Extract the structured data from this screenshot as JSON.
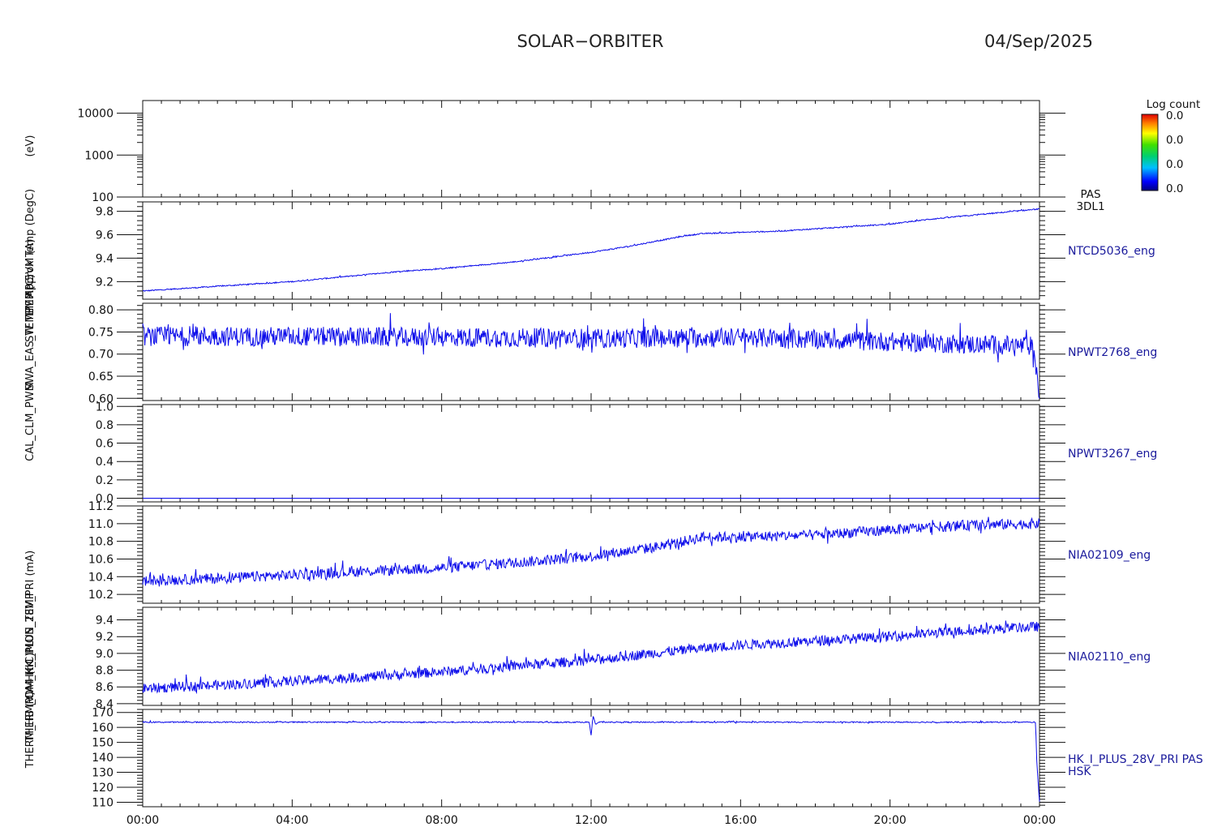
{
  "header": {
    "mission": "SOLAR−ORBITER",
    "date": "04/Sep/2025"
  },
  "colorbar": {
    "title": "Log count",
    "labels": [
      "0.0",
      "0.0",
      "0.0",
      "0.0"
    ]
  },
  "y_axis_labels": [
    "(eV)",
    "Approx Temp (DegC)",
    "TEMP 5VM (A)",
    "SW TEMP (C)",
    "SWA_EAS_TEMP",
    "CAL_CLM_PWM",
    "HK_I_PLUS_28V_PRI (mA)",
    "PDM_HK_IMON_TEMP",
    "THERM_CA4 (nC)",
    "THERM_HB (V)"
  ],
  "chart_data": [
    {
      "type": "heatmap",
      "label": "PAS\n3DL1",
      "label_lines": [
        "PAS",
        "3DL1"
      ],
      "yscale": "log",
      "ylim": [
        100,
        20000
      ],
      "yticks": [
        "100",
        "1000",
        "10000"
      ],
      "values": []
    },
    {
      "type": "line",
      "label": "NTCD5036_eng",
      "ylim": [
        9.05,
        9.88
      ],
      "yticks": [
        "9.2",
        "9.4",
        "9.6",
        "9.8"
      ],
      "x_hours": [
        0,
        1,
        2,
        3,
        4,
        5,
        6,
        7,
        8,
        9,
        10,
        11,
        12,
        13,
        14,
        14.5,
        15,
        16,
        17,
        18,
        19,
        20,
        21,
        22,
        23,
        24
      ],
      "values": [
        9.12,
        9.14,
        9.16,
        9.18,
        9.2,
        9.23,
        9.26,
        9.29,
        9.31,
        9.34,
        9.37,
        9.41,
        9.45,
        9.5,
        9.56,
        9.59,
        9.61,
        9.62,
        9.63,
        9.65,
        9.67,
        9.69,
        9.73,
        9.76,
        9.79,
        9.82
      ],
      "noise": 0.005
    },
    {
      "type": "line",
      "label": "NPWT2768_eng",
      "ylim": [
        0.595,
        0.815
      ],
      "yticks": [
        "0.60",
        "0.65",
        "0.70",
        "0.75",
        "0.80"
      ],
      "x_hours": [
        0,
        4,
        8,
        11.9,
        12,
        12.1,
        16,
        20,
        23.8,
        24
      ],
      "values": [
        0.74,
        0.74,
        0.738,
        0.736,
        0.722,
        0.735,
        0.738,
        0.728,
        0.718,
        0.61
      ],
      "noise": 0.022
    },
    {
      "type": "line",
      "label": "NPWT3267_eng",
      "ylim": [
        -0.04,
        1.02
      ],
      "yticks": [
        "0.0",
        "0.2",
        "0.4",
        "0.6",
        "0.8",
        "1.0"
      ],
      "x_hours": [
        0,
        24
      ],
      "values": [
        0.0,
        0.0
      ],
      "noise": 0.0
    },
    {
      "type": "line",
      "label": "NIA02109_eng",
      "ylim": [
        10.1,
        11.2
      ],
      "yticks": [
        "10.2",
        "10.4",
        "10.6",
        "10.8",
        "11.0",
        "11.2"
      ],
      "x_hours": [
        0,
        2,
        4,
        6,
        8,
        10,
        12,
        14,
        15,
        16,
        18,
        20,
        22,
        24
      ],
      "values": [
        10.35,
        10.38,
        10.42,
        10.46,
        10.5,
        10.56,
        10.63,
        10.75,
        10.85,
        10.85,
        10.87,
        10.93,
        10.98,
        11.0
      ],
      "noise": 0.06
    },
    {
      "type": "line",
      "label": "NIA02110_eng",
      "ylim": [
        8.38,
        9.55
      ],
      "yticks": [
        "8.4",
        "8.6",
        "8.8",
        "9.0",
        "9.2",
        "9.4"
      ],
      "x_hours": [
        0,
        2,
        4,
        6,
        8,
        10,
        12,
        14,
        16,
        18,
        20,
        22,
        24
      ],
      "values": [
        8.58,
        8.62,
        8.67,
        8.72,
        8.78,
        8.85,
        8.92,
        9.02,
        9.1,
        9.15,
        9.2,
        9.27,
        9.32
      ],
      "noise": 0.06
    },
    {
      "type": "line",
      "label": "HK_I_PLUS_28V_PRI PAS\nHSK",
      "label_lines": [
        "HK_I_PLUS_28V_PRI PAS",
        "HSK"
      ],
      "ylim": [
        107,
        172
      ],
      "yticks": [
        "110",
        "120",
        "130",
        "140",
        "150",
        "160",
        "170"
      ],
      "x_hours": [
        0,
        11.95,
        12.0,
        12.05,
        12.12,
        12.2,
        23.9,
        23.92,
        24
      ],
      "values": [
        163.5,
        163.5,
        155,
        168,
        162,
        163.5,
        163.5,
        140,
        110
      ],
      "noise": 0.4
    }
  ],
  "x_axis": {
    "tick_labels": [
      "00:00",
      "04:00",
      "08:00",
      "12:00",
      "16:00",
      "20:00",
      "00:00"
    ]
  },
  "colors": {
    "series": "#0b0bea",
    "axis": "#111111",
    "side_label": "#1a1a9c"
  }
}
